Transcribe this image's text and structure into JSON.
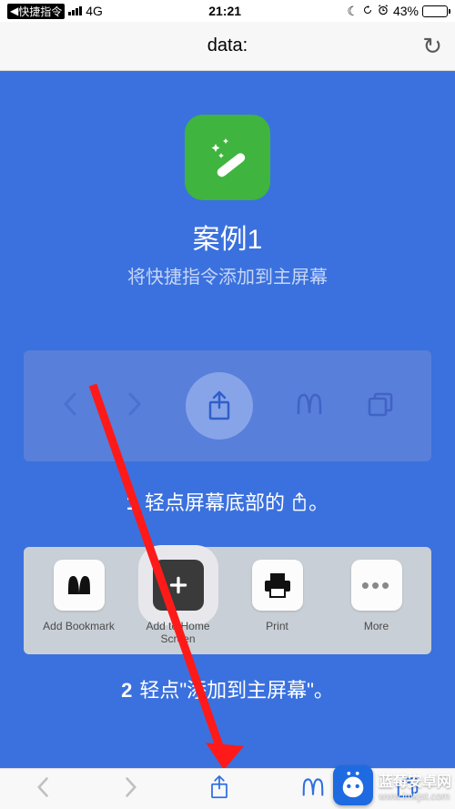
{
  "status": {
    "back_app": "快捷指令",
    "signal": "4G",
    "time": "21:21",
    "battery_pct": "43%"
  },
  "address_bar": {
    "url": "data:"
  },
  "hero": {
    "title": "案例1",
    "subtitle": "将快捷指令添加到主屏幕"
  },
  "step1": {
    "num": "1",
    "text_before": "轻点屏幕底部的 ",
    "text_after": "。"
  },
  "share_sheet": {
    "items": [
      {
        "label": "Add Bookmark"
      },
      {
        "label": "Add to Home Screen"
      },
      {
        "label": "Print"
      },
      {
        "label": "More"
      }
    ]
  },
  "step2": {
    "num": "2",
    "text": "轻点\"添加到主屏幕\"。"
  },
  "watermark": {
    "name": "蓝莓安卓网",
    "url": "www.lmkjst.com"
  }
}
